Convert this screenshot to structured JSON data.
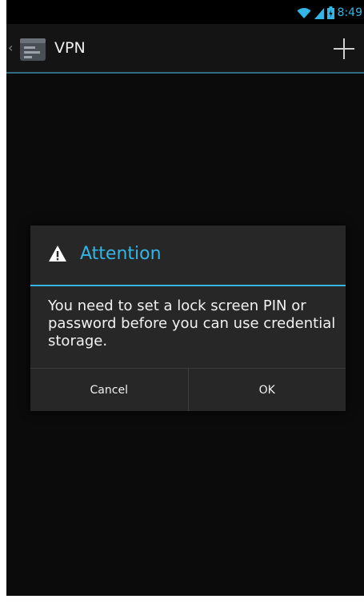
{
  "status_bar": {
    "time": "8:49",
    "icons": [
      "wifi-icon",
      "signal-icon",
      "battery-icon"
    ],
    "accent_color": "#33b5e5"
  },
  "action_bar": {
    "title": "VPN",
    "add_icon": "plus-icon"
  },
  "dialog": {
    "icon": "warning-icon",
    "title": "Attention",
    "message": "You need to set a lock screen PIN or password before you can use credential storage.",
    "buttons": {
      "cancel": "Cancel",
      "ok": "OK"
    },
    "accent_color": "#33b5e5"
  }
}
